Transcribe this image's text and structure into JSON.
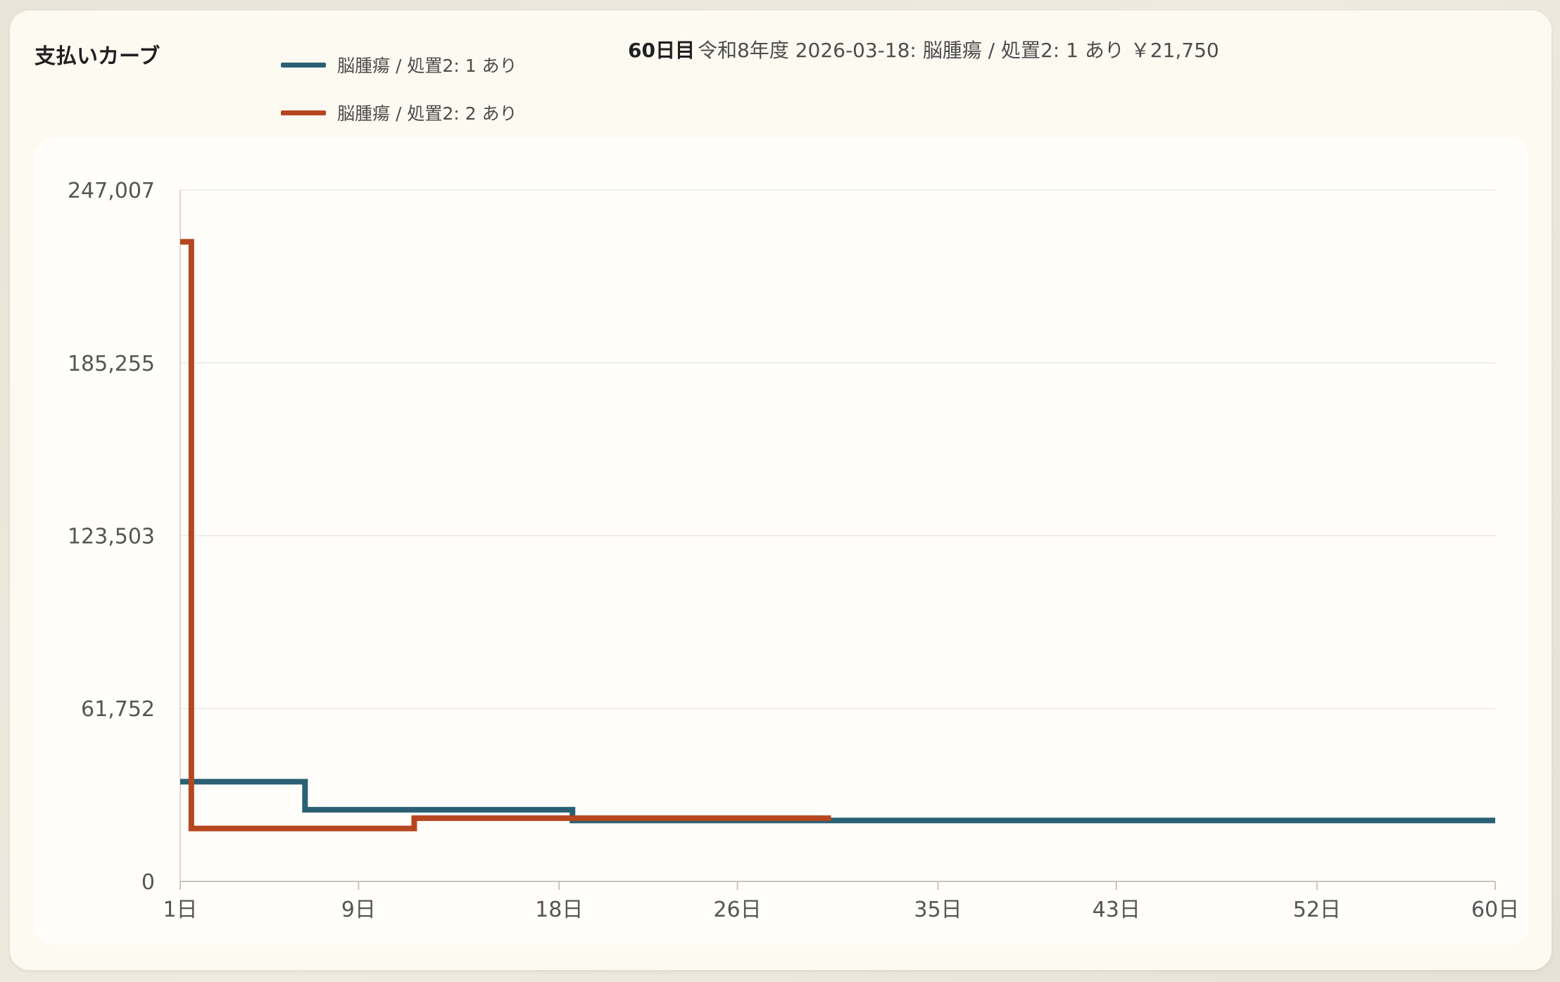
{
  "title": "支払いカーブ",
  "hover": {
    "day_label": "60日目",
    "detail": "令和8年度 2026-03-18: 脳腫瘍 / 処置2: 1 あり ￥21,750"
  },
  "chart_data": {
    "type": "line",
    "step": true,
    "ylim": [
      0,
      247007
    ],
    "yticks": [
      0,
      61752,
      123503,
      185255,
      247007
    ],
    "ytick_labels": [
      "0",
      "61,752",
      "123,503",
      "185,255",
      "247,007"
    ],
    "xlim": [
      1,
      60
    ],
    "xticks": [
      1,
      9,
      18,
      26,
      35,
      43,
      52,
      60
    ],
    "xtick_labels": [
      "1日",
      "9日",
      "18日",
      "26日",
      "35日",
      "43日",
      "52日",
      "60日"
    ],
    "grid": true,
    "legend_position": "top",
    "series": [
      {
        "name": "脳腫瘍 / 処置2: 1 あり",
        "color": "#2a6073",
        "points": [
          [
            1,
            35600
          ],
          [
            6.6,
            35600
          ],
          [
            6.6,
            25600
          ],
          [
            18.6,
            25600
          ],
          [
            18.6,
            21750
          ],
          [
            60,
            21750
          ]
        ]
      },
      {
        "name": "脳腫瘍 / 処置2: 2 あり",
        "color": "#b5461f",
        "points": [
          [
            1,
            228500
          ],
          [
            1.5,
            228500
          ],
          [
            1.5,
            18900
          ],
          [
            11.5,
            18900
          ],
          [
            11.5,
            22600
          ],
          [
            30.2,
            22600
          ]
        ]
      }
    ]
  }
}
